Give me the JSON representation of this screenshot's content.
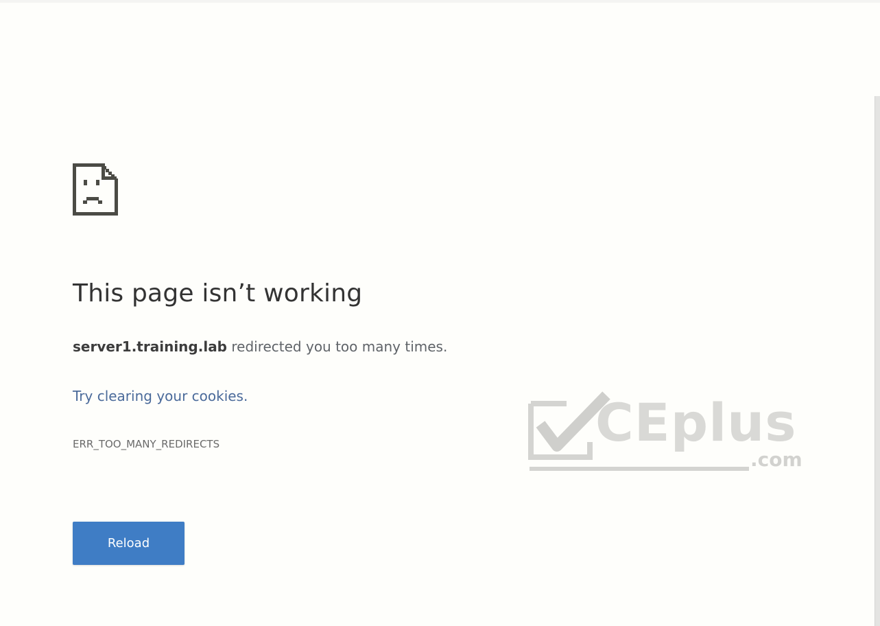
{
  "error_page": {
    "icon": "sad-document-icon",
    "title": "This page isn’t working",
    "host": "server1.training.lab",
    "message_rest": " redirected you too many times.",
    "suggestion": "Try clearing your cookies.",
    "error_code": "ERR_TOO_MANY_REDIRECTS",
    "reload_label": "Reload"
  },
  "watermark": {
    "icon": "check-mark-icon",
    "word": "CEplus",
    "tld": ".com"
  },
  "colors": {
    "background": "#fefefb",
    "button": "#3f7dc5",
    "link": "#4a6a9a",
    "title": "#333333",
    "watermark": "#d9d9d6"
  }
}
